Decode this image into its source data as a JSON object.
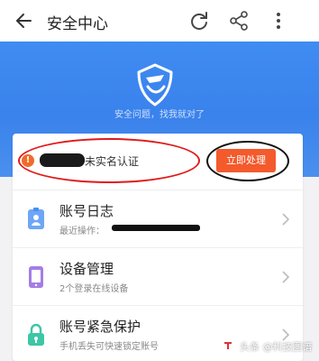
{
  "header": {
    "title": "安全中心"
  },
  "hero": {
    "slogan": "安全问题，找我就对了"
  },
  "warning": {
    "text": "未实名认证",
    "button_label": "立即处理"
  },
  "rows": [
    {
      "title": "账号日志",
      "subtitle": "最近操作：",
      "icon": "id-card-icon"
    },
    {
      "title": "设备管理",
      "subtitle": "2个登录在线设备",
      "icon": "phone-icon"
    },
    {
      "title": "账号紧急保护",
      "subtitle": "手机丢失可快速锁定账号",
      "icon": "lock-icon"
    }
  ],
  "watermark": {
    "text": "头条 @科技图谱"
  },
  "colors": {
    "brand_blue": "#3f8cf2",
    "action_orange": "#f35a2c",
    "annotation_red": "#e01a1a"
  }
}
